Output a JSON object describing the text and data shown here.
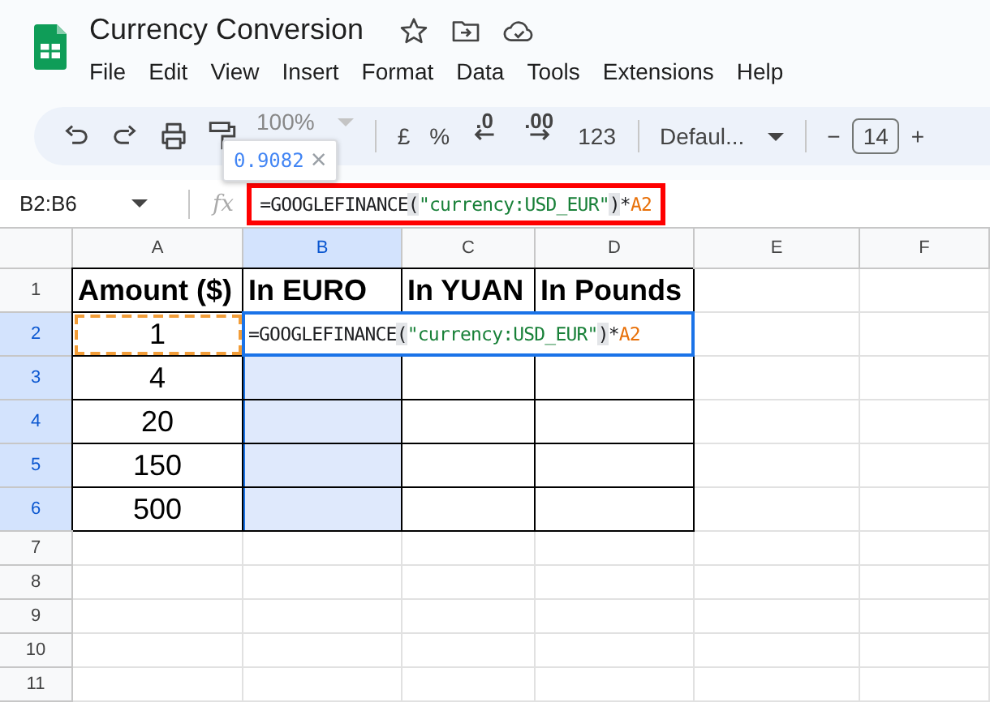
{
  "document": {
    "title": "Currency Conversion",
    "starred": false
  },
  "menu": [
    "File",
    "Edit",
    "View",
    "Insert",
    "Format",
    "Data",
    "Tools",
    "Extensions",
    "Help"
  ],
  "toolbar": [
    {
      "kind": "undo"
    },
    {
      "kind": "redo"
    },
    {
      "kind": "print"
    },
    {
      "kind": "paint_format"
    },
    {
      "kind": "dropdown",
      "text": "100%",
      "disabled": true
    },
    {
      "kind": "sep"
    },
    {
      "kind": "text",
      "text": "£"
    },
    {
      "kind": "text",
      "text": "%"
    },
    {
      "kind": "decrease_decimal",
      "text": ".0"
    },
    {
      "kind": "increase_decimal",
      "text": ".00"
    },
    {
      "kind": "text",
      "text": "123"
    },
    {
      "kind": "sep"
    },
    {
      "kind": "dropdown",
      "text": "Defaul...",
      "disabled": false
    },
    {
      "kind": "sep"
    },
    {
      "kind": "text",
      "text": "−"
    },
    {
      "kind": "field",
      "text": "14"
    },
    {
      "kind": "text",
      "text": "+"
    }
  ],
  "tooltip": {
    "value": "0.9082",
    "close": "×"
  },
  "formula_bar": {
    "name_box": "B2:B6",
    "fx": "fx",
    "highlighted": true,
    "tokens": [
      {
        "kind": "plain",
        "text": "=GOOGLEFINANCE"
      },
      {
        "kind": "paren",
        "text": "("
      },
      {
        "kind": "string",
        "text": "\"currency:USD_EUR\""
      },
      {
        "kind": "paren",
        "text": ")"
      },
      {
        "kind": "plain",
        "text": "*"
      },
      {
        "kind": "ref",
        "text": "A2"
      }
    ]
  },
  "sheet": {
    "columns": [
      {
        "label": "A",
        "selected": false
      },
      {
        "label": "B",
        "selected": true
      },
      {
        "label": "C",
        "selected": false
      },
      {
        "label": "D",
        "selected": false
      },
      {
        "label": "E",
        "selected": false
      },
      {
        "label": "F",
        "selected": false
      }
    ],
    "rows": [
      {
        "label": "1",
        "selected": false,
        "cells": [
          {
            "kind": "heading",
            "text": "Amount ($)",
            "bordered": true,
            "selected": false
          },
          {
            "kind": "heading",
            "text": "In EURO",
            "bordered": true,
            "selected": false
          },
          {
            "kind": "heading",
            "text": "In YUAN",
            "bordered": true,
            "selected": false
          },
          {
            "kind": "heading",
            "text": "In Pounds",
            "bordered": true,
            "selected": false
          },
          {
            "kind": "empty",
            "selected": false
          },
          {
            "kind": "empty",
            "selected": false
          }
        ]
      },
      {
        "label": "2",
        "selected": true,
        "cells": [
          {
            "kind": "value",
            "text": "1",
            "bordered": true,
            "selected": false,
            "referenced": true
          },
          {
            "kind": "editing"
          },
          {
            "kind": "covered"
          },
          {
            "kind": "covered"
          },
          {
            "kind": "empty",
            "selected": false
          },
          {
            "kind": "empty",
            "selected": false
          }
        ]
      },
      {
        "label": "3",
        "selected": true,
        "cells": [
          {
            "kind": "value",
            "text": "4",
            "bordered": true,
            "selected": false
          },
          {
            "kind": "empty",
            "bordered": true,
            "selected": true
          },
          {
            "kind": "empty",
            "bordered": true,
            "selected": false
          },
          {
            "kind": "empty",
            "bordered": true,
            "selected": false
          },
          {
            "kind": "empty",
            "selected": false
          },
          {
            "kind": "empty",
            "selected": false
          }
        ]
      },
      {
        "label": "4",
        "selected": true,
        "cells": [
          {
            "kind": "value",
            "text": "20",
            "bordered": true,
            "selected": false
          },
          {
            "kind": "empty",
            "bordered": true,
            "selected": true
          },
          {
            "kind": "empty",
            "bordered": true,
            "selected": false
          },
          {
            "kind": "empty",
            "bordered": true,
            "selected": false
          },
          {
            "kind": "empty",
            "selected": false
          },
          {
            "kind": "empty",
            "selected": false
          }
        ]
      },
      {
        "label": "5",
        "selected": true,
        "cells": [
          {
            "kind": "value",
            "text": "150",
            "bordered": true,
            "selected": false
          },
          {
            "kind": "empty",
            "bordered": true,
            "selected": true
          },
          {
            "kind": "empty",
            "bordered": true,
            "selected": false
          },
          {
            "kind": "empty",
            "bordered": true,
            "selected": false
          },
          {
            "kind": "empty",
            "selected": false
          },
          {
            "kind": "empty",
            "selected": false
          }
        ]
      },
      {
        "label": "6",
        "selected": true,
        "cells": [
          {
            "kind": "value",
            "text": "500",
            "bordered": true,
            "selected": false
          },
          {
            "kind": "empty",
            "bordered": true,
            "selected": true
          },
          {
            "kind": "empty",
            "bordered": true,
            "selected": false
          },
          {
            "kind": "empty",
            "bordered": true,
            "selected": false
          },
          {
            "kind": "empty",
            "selected": false
          },
          {
            "kind": "empty",
            "selected": false
          }
        ]
      },
      {
        "label": "7",
        "selected": false
      },
      {
        "label": "8",
        "selected": false
      },
      {
        "label": "9",
        "selected": false
      },
      {
        "label": "10",
        "selected": false
      },
      {
        "label": "11",
        "selected": false
      }
    ],
    "editor": {
      "tokens": [
        {
          "kind": "plain",
          "text": "=GOOGLEFINANCE"
        },
        {
          "kind": "paren",
          "text": "("
        },
        {
          "kind": "string",
          "text": "\"currency:USD_EUR\""
        },
        {
          "kind": "paren",
          "text": ")"
        },
        {
          "kind": "plain",
          "text": "*"
        },
        {
          "kind": "ref",
          "text": "A2"
        }
      ]
    }
  }
}
